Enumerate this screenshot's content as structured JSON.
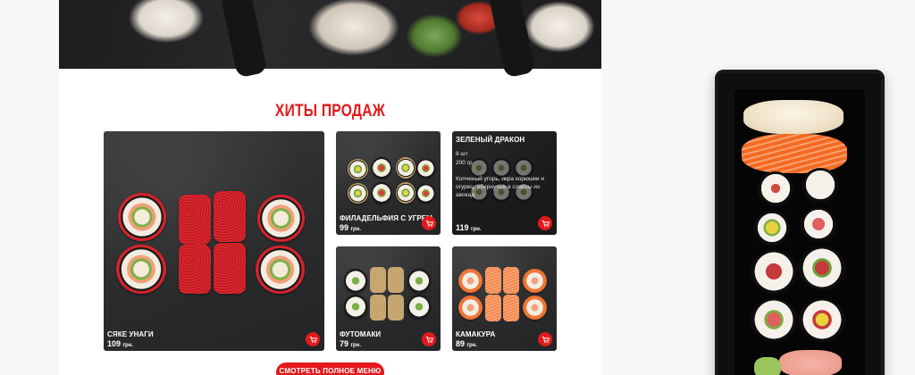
{
  "section": {
    "title": "ХИТЫ ПРОДАЖ",
    "menu_button": "СМОТРЕТЬ ПОЛНОЕ МЕНЮ"
  },
  "products": [
    {
      "name": "СЯКЕ УНАГИ",
      "price": "109",
      "currency": "грн."
    },
    {
      "name": "ФИЛАДЕЛЬФИЯ С УГРЕМ",
      "price": "99",
      "currency": "грн."
    },
    {
      "name": "ЗЕЛЕНЫЙ ДРАКОН",
      "price": "119",
      "currency": "грн.",
      "count": "8 шт",
      "weight": "200 гр",
      "description": "Копченый угорь, икра корюшки и огурец, обернутые в слайсы из авокад"
    },
    {
      "name": "ФУТОМАКИ",
      "price": "79",
      "currency": "грн."
    },
    {
      "name": "КАМАКУРА",
      "price": "89",
      "currency": "грн."
    }
  ],
  "icons": {
    "cart": "cart-icon"
  },
  "colors": {
    "accent": "#e3191b",
    "card_bg": "#2b2c2e"
  }
}
